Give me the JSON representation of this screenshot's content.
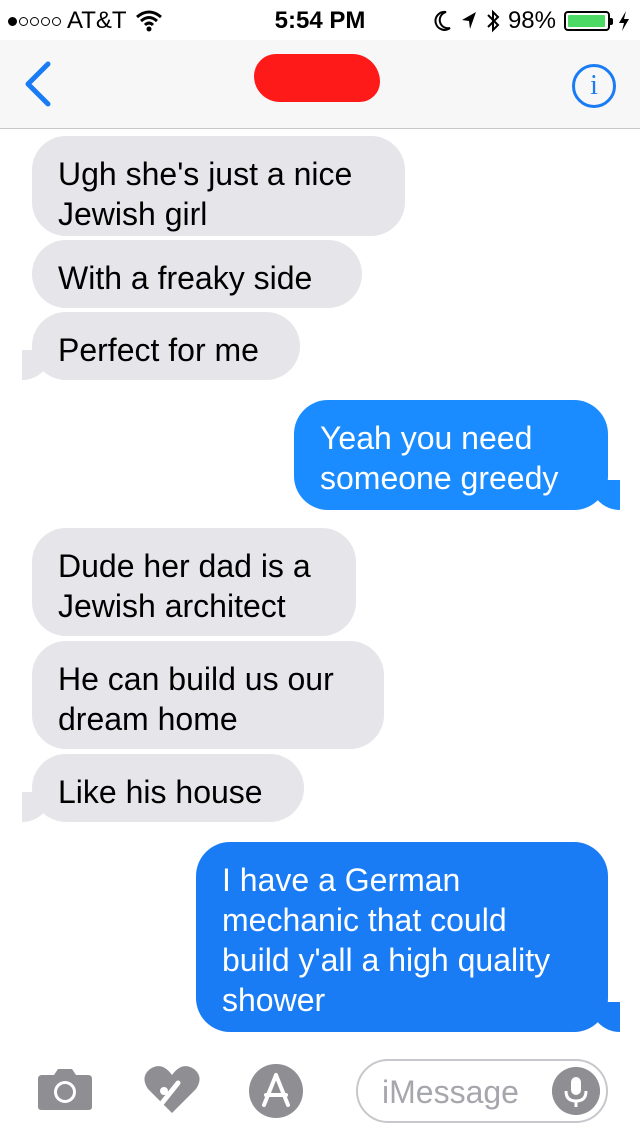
{
  "status_bar": {
    "carrier": "AT&T",
    "time": "5:54 PM",
    "battery_percent": "98%",
    "battery_level": 0.98
  },
  "nav": {
    "back_icon": "chevron-left-icon",
    "info_icon": "info-icon",
    "info_label": "i"
  },
  "messages": [
    {
      "dir": "in",
      "text": "Ugh she's just a nice Jewish girl"
    },
    {
      "dir": "in",
      "text": "With a freaky side"
    },
    {
      "dir": "in",
      "text": "Perfect for me"
    },
    {
      "dir": "out",
      "text": "Yeah you need someone greedy"
    },
    {
      "dir": "in",
      "text": "Dude her dad is a Jewish architect"
    },
    {
      "dir": "in",
      "text": "He can build us our dream home"
    },
    {
      "dir": "in",
      "text": "Like his house"
    },
    {
      "dir": "out",
      "text": "I have a German mechanic that could build y'all a high quality shower"
    }
  ],
  "input_bar": {
    "placeholder": "iMessage",
    "icons": [
      "camera-icon",
      "digital-touch-icon",
      "app-store-icon",
      "microphone-icon"
    ]
  },
  "colors": {
    "incoming_bubble": "#e5e5ea",
    "outgoing_bubble": "#1a8cff",
    "accent": "#1a7cf5",
    "redaction": "#ff1a1a"
  }
}
